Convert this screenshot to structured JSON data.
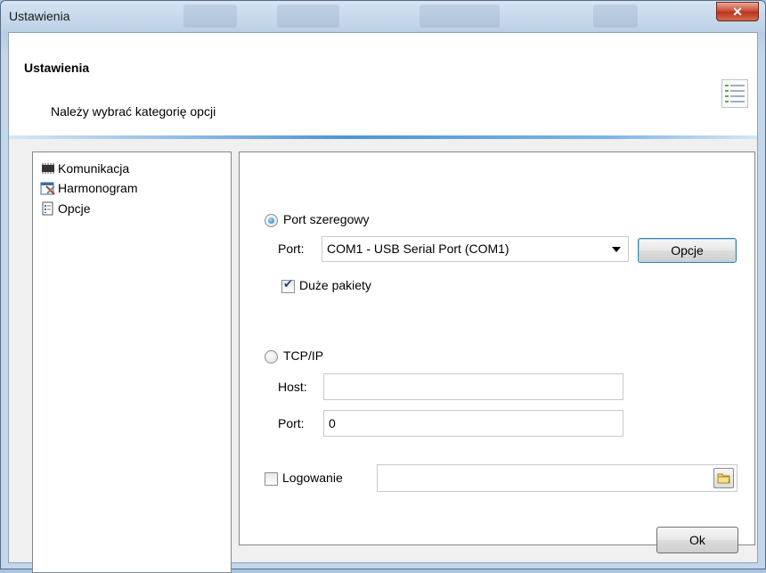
{
  "window": {
    "title": "Ustawienia",
    "close_icon": "close-icon"
  },
  "header": {
    "title": "Ustawienia",
    "subtitle": "Należy wybrać kategorię opcji",
    "icon": "checklist-icon"
  },
  "tree": {
    "items": [
      {
        "label": "Komunikacja",
        "icon": "chip-icon"
      },
      {
        "label": "Harmonogram",
        "icon": "calendar-tools-icon"
      },
      {
        "label": "Opcje",
        "icon": "document-options-icon"
      }
    ]
  },
  "serial": {
    "radio_label": "Port szeregowy",
    "selected": true,
    "port_label": "Port:",
    "port_value": "COM1 - USB Serial Port (COM1)",
    "options_button": "Opcje",
    "big_packets_label": "Duże pakiety",
    "big_packets_checked": true
  },
  "tcp": {
    "radio_label": "TCP/IP",
    "selected": false,
    "host_label": "Host:",
    "host_value": "",
    "port_label": "Port:",
    "port_value": "0"
  },
  "logging": {
    "label": "Logowanie",
    "checked": false,
    "path_value": "",
    "browse_icon": "folder-icon"
  },
  "footer": {
    "ok_button": "Ok"
  }
}
